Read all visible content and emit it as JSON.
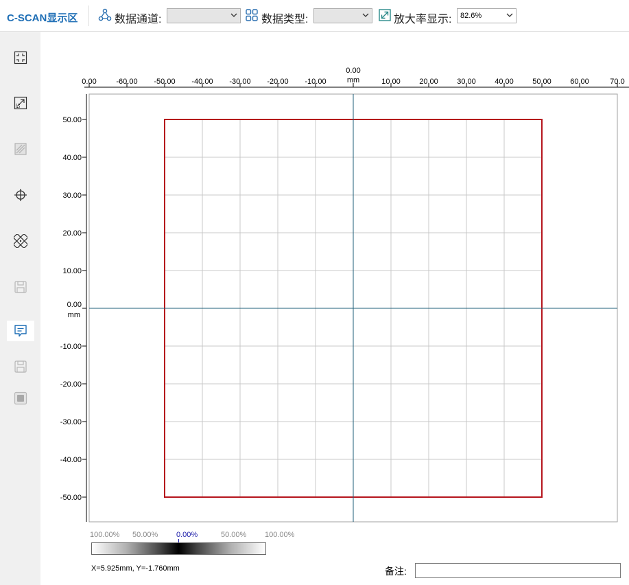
{
  "toolbar": {
    "title": "C-SCAN显示区",
    "channel_label": "数据通道:",
    "channel_value": "",
    "type_label": "数据类型:",
    "type_value": "",
    "zoom_label": "放大率显示:",
    "zoom_value": "82.6%"
  },
  "sidebar": {
    "buttons": [
      {
        "icon": "fit-view-icon",
        "enabled": true
      },
      {
        "icon": "expand-icon",
        "enabled": true
      },
      {
        "icon": "hatch-fill-icon",
        "enabled": false
      },
      {
        "icon": "crosshair-icon",
        "enabled": true
      },
      {
        "icon": "pattern-fill-icon",
        "enabled": true
      },
      {
        "icon": "save-icon",
        "enabled": false
      },
      {
        "icon": "comment-icon",
        "enabled": true,
        "active": true
      },
      {
        "icon": "save-as-icon",
        "enabled": false
      },
      {
        "icon": "image-icon",
        "enabled": false
      }
    ]
  },
  "plot": {
    "x_ticks": [
      "0.00",
      "-60.00",
      "-50.00",
      "-40.00",
      "-30.00",
      "-20.00",
      "-10.00",
      "0.00",
      "10.00",
      "20.00",
      "30.00",
      "40.00",
      "50.00",
      "60.00",
      "70.0"
    ],
    "x_unit": "mm",
    "y_ticks": [
      "50.00",
      "40.00",
      "30.00",
      "20.00",
      "10.00",
      "0.00",
      "-10.00",
      "-20.00",
      "-30.00",
      "-40.00",
      "-50.00"
    ],
    "y_unit": "mm",
    "x_range": [
      -70,
      70
    ],
    "y_range": [
      -55,
      57
    ],
    "scan_area": {
      "x_min": -50,
      "x_max": 50,
      "y_min": -50,
      "y_max": 50,
      "color": "#b5141c"
    },
    "axis_color": "#1f5f7a",
    "grid_color": "#c8c8c8"
  },
  "colorbar": {
    "labels": [
      "100.00%",
      "50.00%",
      "0.00%",
      "50.00%",
      "100.00%"
    ]
  },
  "status": {
    "coords": "X=5.925mm, Y=-1.760mm",
    "note_label": "备注:",
    "note_value": ""
  }
}
